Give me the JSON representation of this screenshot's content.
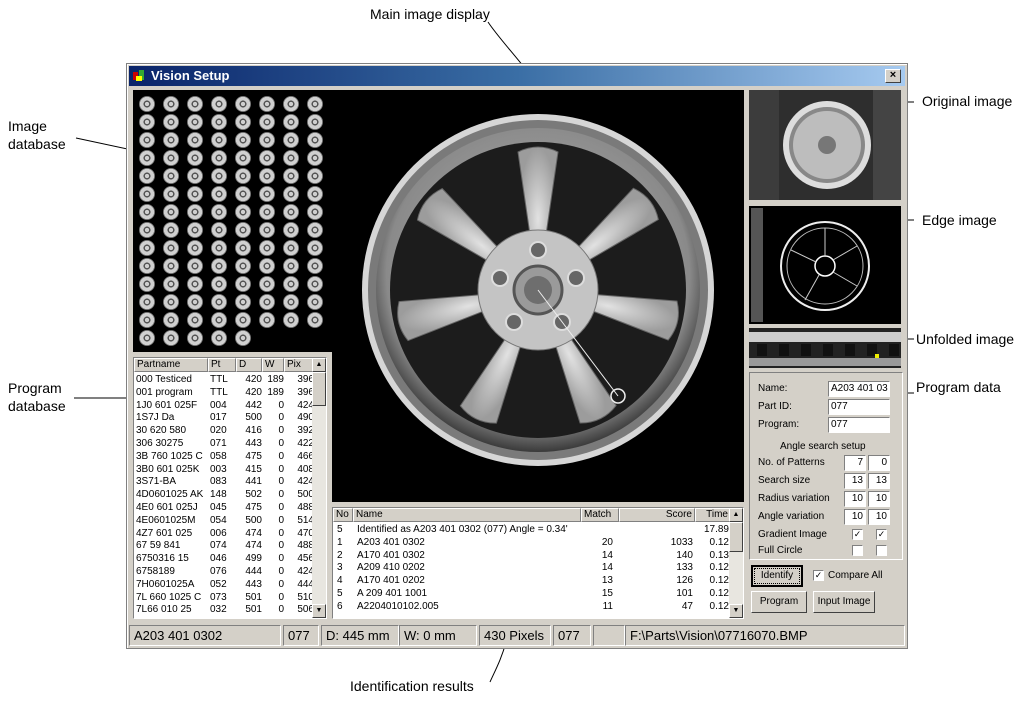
{
  "callouts": {
    "main_image_display": "Main image display",
    "image_database": [
      "Image",
      "database"
    ],
    "original_image": "Original image",
    "edge_image": "Edge image",
    "unfolded_image": "Unfolded image",
    "program_data": "Program data",
    "program_database": [
      "Program",
      "database"
    ],
    "identification_results": "Identification results"
  },
  "window": {
    "title": "Vision Setup",
    "close_glyph": "×"
  },
  "program_database": {
    "columns": [
      "Partname",
      "Pt",
      "D",
      "W",
      "Pix"
    ],
    "rows": [
      [
        "000 Testiced",
        "TTL",
        "420",
        "189",
        "396"
      ],
      [
        "001 program",
        "TTL",
        "420",
        "189",
        "396"
      ],
      [
        "1J0 601 025F",
        "004",
        "442",
        "0",
        "424"
      ],
      [
        "1S7J Da",
        "017",
        "500",
        "0",
        "490"
      ],
      [
        "30 620 580",
        "020",
        "416",
        "0",
        "392"
      ],
      [
        "306 30275",
        "071",
        "443",
        "0",
        "422"
      ],
      [
        "3B 760 1025 C",
        "058",
        "475",
        "0",
        "466"
      ],
      [
        "3B0 601 025K",
        "003",
        "415",
        "0",
        "408"
      ],
      [
        "3S71-BA",
        "083",
        "441",
        "0",
        "424"
      ],
      [
        "4D0601025 AK",
        "148",
        "502",
        "0",
        "500"
      ],
      [
        "4E0 601 025J",
        "045",
        "475",
        "0",
        "488"
      ],
      [
        "4E0601025M",
        "054",
        "500",
        "0",
        "514"
      ],
      [
        "4Z7 601 025",
        "006",
        "474",
        "0",
        "470"
      ],
      [
        "67 59 841",
        "074",
        "474",
        "0",
        "488"
      ],
      [
        "6750316 15",
        "046",
        "499",
        "0",
        "456"
      ],
      [
        "6758189",
        "076",
        "444",
        "0",
        "424"
      ],
      [
        "7H0601025A",
        "052",
        "443",
        "0",
        "444"
      ],
      [
        "7L 660 1025 C",
        "073",
        "501",
        "0",
        "510"
      ],
      [
        "7L66 010 25",
        "032",
        "501",
        "0",
        "506"
      ]
    ],
    "scroll_up": "▲",
    "scroll_down": "▼"
  },
  "results": {
    "columns": [
      "No",
      "Name",
      "Match",
      "Score",
      "Time"
    ],
    "rows": [
      [
        "5",
        "Identified as A203 401 0302 (077)  Angle = 0.34'",
        "",
        "",
        "17.89"
      ],
      [
        "1",
        "A203 401 0302",
        "20",
        "1033",
        "0.12"
      ],
      [
        "2",
        "A170 401 0302",
        "14",
        "140",
        "0.13"
      ],
      [
        "3",
        "A209 410 0202",
        "14",
        "133",
        "0.12"
      ],
      [
        "4",
        "A170 401 0202",
        "13",
        "126",
        "0.12"
      ],
      [
        "5",
        "A 209 401 1001",
        "15",
        "101",
        "0.12"
      ],
      [
        "6",
        "A2204010102.005",
        "11",
        "47",
        "0.12"
      ]
    ],
    "scroll_up": "▲",
    "scroll_down": "▼"
  },
  "program_data": {
    "name_label": "Name:",
    "name_value": "A203 401 03",
    "partid_label": "Part ID:",
    "partid_value": "077",
    "program_label": "Program:",
    "program_value": "077",
    "angle_header": "Angle search setup",
    "params": [
      {
        "label": "No. of Patterns",
        "a": "7",
        "b": "0"
      },
      {
        "label": "Search size",
        "a": "13",
        "b": "13"
      },
      {
        "label": "Radius variation",
        "a": "10",
        "b": "10"
      },
      {
        "label": "Angle variation",
        "a": "10",
        "b": "10"
      }
    ],
    "gradient_label": "Gradient Image",
    "gradient_a": true,
    "gradient_b": true,
    "fullcircle_label": "Full Circle",
    "fullcircle_a": false,
    "fullcircle_b": false
  },
  "buttons": {
    "identify": "Identify",
    "compare_all": "Compare All",
    "compare_all_checked": true,
    "program": "Program",
    "input_image": "Input Image"
  },
  "status": {
    "part_name": "A203 401 0302",
    "part_id": "077",
    "diameter": "D: 445 mm",
    "width": "W: 0 mm",
    "pixels": "430 Pixels",
    "program": "077",
    "file_path": "F:\\Parts\\Vision\\07716070.BMP"
  },
  "check_glyph": "✓"
}
